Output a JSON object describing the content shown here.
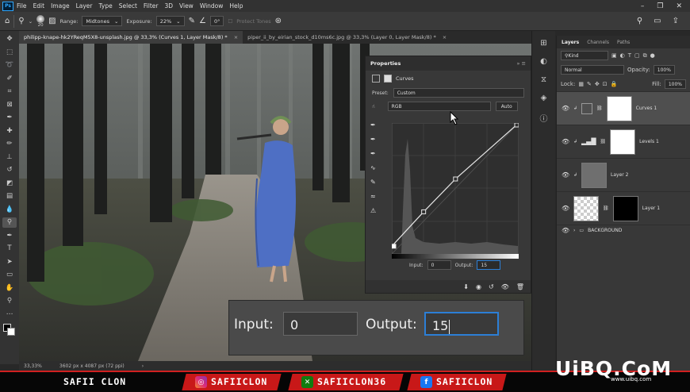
{
  "menu": {
    "logo": "Ps",
    "items": [
      "File",
      "Edit",
      "Image",
      "Layer",
      "Type",
      "Select",
      "Filter",
      "3D",
      "View",
      "Window",
      "Help"
    ]
  },
  "options_bar": {
    "brush_size": "20",
    "range_label": "Range:",
    "range_value": "Midtones",
    "exposure_label": "Exposure:",
    "exposure_value": "22%",
    "angle_value": "0°",
    "protect_tones": "Protect Tones"
  },
  "tabs": [
    {
      "label": "philipp-knape-hk2YReqM5X8-unsplash.jpg @ 33,3% (Curves 1, Layer Mask/8) *",
      "close": "×"
    },
    {
      "label": "piper_ii_by_eirian_stock_d10ms6c.jpg @ 33,3% (Layer 0, Layer Mask/8) *",
      "close": "×"
    }
  ],
  "status_bar": {
    "zoom": "33,33%",
    "doc_size": "3602 px x 4087 px (72 ppi)"
  },
  "properties": {
    "panel_title": "Properties",
    "adjustment_name": "Curves",
    "preset_label": "Preset:",
    "preset_value": "Custom",
    "channel_value": "RGB",
    "auto_label": "Auto",
    "input_label": "Input:",
    "input_value": "0",
    "output_label": "Output:",
    "output_value": "15"
  },
  "zoom_overlay": {
    "input_label": "Input:",
    "input_value": "0",
    "output_label": "Output:",
    "output_value": "15"
  },
  "layers_panel": {
    "tabs": [
      "Layers",
      "Channels",
      "Paths"
    ],
    "kind_label": "Kind",
    "blend_mode": "Normal",
    "opacity_label": "Opacity:",
    "opacity_value": "100%",
    "lock_label": "Lock:",
    "fill_label": "Fill:",
    "fill_value": "100%",
    "layers": [
      {
        "name": "Curves 1",
        "selected": true
      },
      {
        "name": "Levels 1",
        "selected": false
      },
      {
        "name": "Layer 2",
        "selected": false
      },
      {
        "name": "Layer 1",
        "selected": false
      },
      {
        "name": "BACKGROUND",
        "selected": false
      }
    ]
  },
  "banner": {
    "name": "SAFII CLON",
    "instagram": "SAFIICLON",
    "xbox": "SAFIICLON36",
    "facebook": "SAFIICLON"
  },
  "watermark": {
    "text": "UiBQ.CoM",
    "url": "www.uibq.com"
  },
  "colors": {
    "accent": "#2c7fd6",
    "banner_red": "#c81818",
    "panel_bg": "#383838"
  },
  "curve_points": [
    {
      "input": 0,
      "output": 15
    },
    {
      "input": 64,
      "output": 82
    },
    {
      "input": 128,
      "output": 146
    },
    {
      "input": 255,
      "output": 255
    }
  ]
}
